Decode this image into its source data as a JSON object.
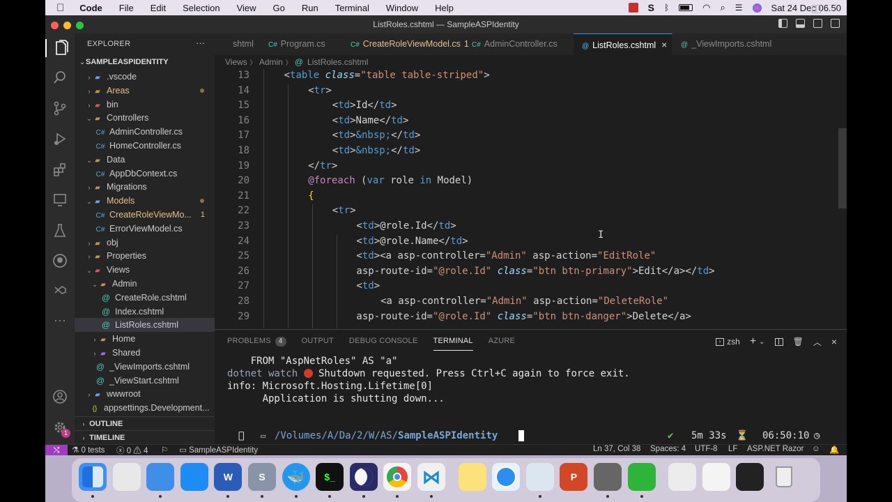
{
  "menubar": {
    "app": "Code",
    "items": [
      "File",
      "Edit",
      "Selection",
      "View",
      "Go",
      "Run",
      "Terminal",
      "Window",
      "Help"
    ],
    "clock": "Sat 24 Dec 06.50"
  },
  "window": {
    "title": "ListRoles.cshtml — SampleASPIdentity"
  },
  "sidebar": {
    "header": "EXPLORER",
    "project": "SAMPLEASPIDENTITY",
    "tree": [
      {
        "label": ".vscode",
        "depth": 0,
        "kind": "folder",
        "open": false,
        "icon_color": "#6c9ef8"
      },
      {
        "label": "Areas",
        "depth": 0,
        "kind": "folder",
        "open": false,
        "color": "#e2c08d",
        "dot": true
      },
      {
        "label": "bin",
        "depth": 0,
        "kind": "folder",
        "open": false,
        "icon_color": "#e05555"
      },
      {
        "label": "Controllers",
        "depth": 0,
        "kind": "folder",
        "open": true
      },
      {
        "label": "AdminController.cs",
        "depth": 1,
        "kind": "cs"
      },
      {
        "label": "HomeController.cs",
        "depth": 1,
        "kind": "cs"
      },
      {
        "label": "Data",
        "depth": 0,
        "kind": "folder",
        "open": true
      },
      {
        "label": "AppDbContext.cs",
        "depth": 1,
        "kind": "cs"
      },
      {
        "label": "Migrations",
        "depth": 0,
        "kind": "folder",
        "open": false
      },
      {
        "label": "Models",
        "depth": 0,
        "kind": "folder",
        "open": true,
        "color": "#e2c08d",
        "dot": true,
        "icon_color": "#6c9ef8"
      },
      {
        "label": "CreateRoleViewMo...",
        "depth": 1,
        "kind": "cs",
        "color": "#e2c08d",
        "badge": "1"
      },
      {
        "label": "ErrorViewModel.cs",
        "depth": 1,
        "kind": "cs"
      },
      {
        "label": "obj",
        "depth": 0,
        "kind": "folder",
        "open": false
      },
      {
        "label": "Properties",
        "depth": 0,
        "kind": "folder",
        "open": false
      },
      {
        "label": "Views",
        "depth": 0,
        "kind": "folder",
        "open": true,
        "icon_color": "#e05555"
      },
      {
        "label": "Admin",
        "depth": 1,
        "kind": "folder",
        "open": true
      },
      {
        "label": "CreateRole.cshtml",
        "depth": 2,
        "kind": "razor"
      },
      {
        "label": "Index.cshtml",
        "depth": 2,
        "kind": "razor"
      },
      {
        "label": "ListRoles.cshtml",
        "depth": 2,
        "kind": "razor",
        "selected": true
      },
      {
        "label": "Home",
        "depth": 1,
        "kind": "folder",
        "open": false
      },
      {
        "label": "Shared",
        "depth": 1,
        "kind": "folder",
        "open": false,
        "icon_color": "#9a6cf0"
      },
      {
        "label": "_ViewImports.cshtml",
        "depth": 1,
        "kind": "razor"
      },
      {
        "label": "_ViewStart.cshtml",
        "depth": 1,
        "kind": "razor"
      },
      {
        "label": "wwwroot",
        "depth": 0,
        "kind": "folder",
        "open": false,
        "icon_color": "#6c9ef8"
      },
      {
        "label": "appsettings.Development...",
        "depth": 0,
        "kind": "json"
      }
    ],
    "outline": "OUTLINE",
    "timeline": "TIMELINE"
  },
  "tabs": [
    {
      "label": "shtml",
      "icon": "",
      "partial": true
    },
    {
      "label": "Program.cs",
      "icon": "C#"
    },
    {
      "label": "CreateRoleViewModel.cs",
      "icon": "C#",
      "modified": true,
      "badge": "1"
    },
    {
      "label": "AdminController.cs",
      "icon": "C#"
    },
    {
      "label": "ListRoles.cshtml",
      "icon": "@",
      "active": true,
      "close": "×"
    },
    {
      "label": "_ViewImports.cshtml",
      "icon": "@"
    }
  ],
  "breadcrumb": {
    "parts": [
      "Views",
      "Admin",
      "ListRoles.cshtml"
    ],
    "sep": "〉",
    "razor_icon": "@"
  },
  "editor": {
    "lines": [
      {
        "n": "13",
        "indent": 1,
        "t": [
          [
            "<",
            "p"
          ],
          [
            "table",
            "tag"
          ],
          [
            " class",
            "attr-i"
          ],
          [
            "=",
            "p"
          ],
          [
            "\"table table-striped\"",
            "str"
          ],
          [
            ">",
            "p"
          ]
        ]
      },
      {
        "n": "14",
        "indent": 2,
        "t": [
          [
            "<",
            "p"
          ],
          [
            "tr",
            "tag"
          ],
          [
            ">",
            "p"
          ]
        ]
      },
      {
        "n": "15",
        "indent": 3,
        "t": [
          [
            "<",
            "p"
          ],
          [
            "td",
            "tag"
          ],
          [
            ">Id</",
            "p"
          ],
          [
            "td",
            "tag"
          ],
          [
            ">",
            "p"
          ]
        ]
      },
      {
        "n": "16",
        "indent": 3,
        "t": [
          [
            "<",
            "p"
          ],
          [
            "td",
            "tag"
          ],
          [
            ">Name</",
            "p"
          ],
          [
            "td",
            "tag"
          ],
          [
            ">",
            "p"
          ]
        ]
      },
      {
        "n": "17",
        "indent": 3,
        "t": [
          [
            "<",
            "p"
          ],
          [
            "td",
            "tag"
          ],
          [
            ">",
            "p"
          ],
          [
            "&nbsp;",
            "ent"
          ],
          [
            "</",
            "p"
          ],
          [
            "td",
            "tag"
          ],
          [
            ">",
            "p"
          ]
        ]
      },
      {
        "n": "18",
        "indent": 3,
        "t": [
          [
            "<",
            "p"
          ],
          [
            "td",
            "tag"
          ],
          [
            ">",
            "p"
          ],
          [
            "&nbsp;",
            "ent"
          ],
          [
            "</",
            "p"
          ],
          [
            "td",
            "tag"
          ],
          [
            ">",
            "p"
          ]
        ]
      },
      {
        "n": "19",
        "indent": 2,
        "t": [
          [
            "</",
            "p"
          ],
          [
            "tr",
            "tag"
          ],
          [
            ">",
            "p"
          ]
        ]
      },
      {
        "n": "20",
        "indent": 2,
        "t": [
          [
            "@foreach",
            "kw"
          ],
          [
            " (",
            "p"
          ],
          [
            "var",
            "kw2"
          ],
          [
            " role ",
            "p"
          ],
          [
            "in",
            "kw2"
          ],
          [
            " Model)",
            "p"
          ]
        ]
      },
      {
        "n": "21",
        "indent": 2,
        "t": [
          [
            "{",
            "brace"
          ]
        ]
      },
      {
        "n": "22",
        "indent": 3,
        "t": [
          [
            "<",
            "p"
          ],
          [
            "tr",
            "tag"
          ],
          [
            ">",
            "p"
          ]
        ]
      },
      {
        "n": "23",
        "indent": 4,
        "t": [
          [
            "<",
            "p"
          ],
          [
            "td",
            "tag"
          ],
          [
            ">@role.Id</",
            "p"
          ],
          [
            "td",
            "tag"
          ],
          [
            ">",
            "p"
          ]
        ]
      },
      {
        "n": "24",
        "indent": 4,
        "t": [
          [
            "<",
            "p"
          ],
          [
            "td",
            "tag"
          ],
          [
            ">@role.Name</",
            "p"
          ],
          [
            "td",
            "tag"
          ],
          [
            ">",
            "p"
          ]
        ]
      },
      {
        "n": "25",
        "indent": 4,
        "t": [
          [
            "<",
            "p"
          ],
          [
            "td",
            "tag"
          ],
          [
            "><a asp-controller=",
            "p"
          ],
          [
            "\"Admin\"",
            "str"
          ],
          [
            " asp-action=",
            "p"
          ],
          [
            "\"EditRole\"",
            "str"
          ]
        ]
      },
      {
        "n": "26",
        "indent": 4,
        "t": [
          [
            "asp-route-id=",
            "p"
          ],
          [
            "\"@role.Id\"",
            "str"
          ],
          [
            " class",
            "attr-i"
          ],
          [
            "=",
            "p"
          ],
          [
            "\"btn btn-primary\"",
            "str"
          ],
          [
            ">Edit</a></",
            "p"
          ],
          [
            "td",
            "tag"
          ],
          [
            ">",
            "p"
          ]
        ]
      },
      {
        "n": "27",
        "indent": 4,
        "t": [
          [
            "<",
            "p"
          ],
          [
            "td",
            "tag"
          ],
          [
            ">",
            "p"
          ]
        ]
      },
      {
        "n": "28",
        "indent": 5,
        "t": [
          [
            "<a asp-controller=",
            "p"
          ],
          [
            "\"Admin\"",
            "str"
          ],
          [
            " asp-action=",
            "p"
          ],
          [
            "\"DeleteRole\"",
            "str"
          ]
        ]
      },
      {
        "n": "29",
        "indent": 4,
        "t": [
          [
            "asp-route-id=",
            "p"
          ],
          [
            "\"@role.Id\"",
            "str"
          ],
          [
            " class",
            "attr-i"
          ],
          [
            "=",
            "p"
          ],
          [
            "\"btn btn-danger\"",
            "str"
          ],
          [
            ">Delete</a>",
            "p"
          ]
        ]
      }
    ]
  },
  "panel": {
    "tabs": [
      {
        "label": "PROBLEMS",
        "badge": "4"
      },
      {
        "label": "OUTPUT"
      },
      {
        "label": "DEBUG CONSOLE"
      },
      {
        "label": "TERMINAL",
        "active": true
      },
      {
        "label": "AZURE"
      }
    ],
    "shell": "zsh",
    "terminal": [
      {
        "pre": "    FROM \"AspNetRoles\" AS \"a\"",
        "text": ""
      },
      {
        "pre": "dotnet watch ",
        "stop": true,
        "text": " Shutdown requested. Press Ctrl+C again to force exit."
      },
      {
        "pre": "info: Microsoft.Hosting.Lifetime[0]",
        "text": ""
      },
      {
        "pre": "      Application is shutting down...",
        "text": ""
      }
    ],
    "prompt": {
      "path_dim": "/Volumes/A/Da/2/W/AS/",
      "path_bold": "SampleASPIdentity",
      "ok": "✔",
      "duration": "5m 33s",
      "time": "06:50:10"
    }
  },
  "statusbar": {
    "tests": "0 tests",
    "errors": "0",
    "warnings": "4",
    "project": "SampleASPIdentity",
    "position": "Ln 37, Col 38",
    "spaces": "Spaces: 4",
    "encoding": "UTF-8",
    "eol": "LF",
    "language": "ASP.NET Razor"
  },
  "dock": {
    "apps": [
      {
        "name": "finder-icon",
        "label": "",
        "bg": "#3d8ff0"
      },
      {
        "name": "launchpad-icon",
        "label": "",
        "bg": "#e8e8e8"
      },
      {
        "name": "mail-icon",
        "label": "",
        "bg": "#3f8fe8"
      },
      {
        "name": "app-store-icon",
        "label": "",
        "bg": "#1d8cf5"
      },
      {
        "name": "word-icon",
        "label": "W",
        "bg": "#2b5cb8"
      },
      {
        "name": "sonar-icon",
        "label": "S",
        "bg": "#8a94a8"
      },
      {
        "name": "docker-icon",
        "label": "",
        "bg": "#2496ed"
      },
      {
        "name": "terminal-icon",
        "label": "$_",
        "bg": "#111"
      },
      {
        "name": "eclipse-icon",
        "label": "",
        "bg": "#2a2b66"
      },
      {
        "name": "chrome-icon",
        "label": "",
        "bg": "#f4f4f4"
      },
      {
        "name": "vscode-icon",
        "label": "",
        "bg": "#f0f0f0"
      },
      {
        "name": "notes-icon",
        "label": "",
        "bg": "#fbe27a"
      },
      {
        "name": "safari-icon",
        "label": "",
        "bg": "#e8f2fc"
      },
      {
        "name": "preview-icon",
        "label": "",
        "bg": "#dce6f0"
      },
      {
        "name": "powerpoint-icon",
        "label": "P",
        "bg": "#d24726"
      },
      {
        "name": "database-icon",
        "label": "",
        "bg": "#666"
      },
      {
        "name": "camtasia-icon",
        "label": "",
        "bg": "#2fb43a"
      },
      {
        "name": "window-1-icon",
        "label": "",
        "bg": "#ececec"
      },
      {
        "name": "window-2-icon",
        "label": "",
        "bg": "#f4f4f4"
      },
      {
        "name": "window-3-icon",
        "label": "",
        "bg": "#222"
      },
      {
        "name": "trash-icon",
        "label": "",
        "bg": "#d8d8dc"
      }
    ]
  },
  "colors": {
    "accent": "#3a8ee6",
    "remote": "#a03dbf",
    "tag": "#569cd6",
    "string": "#ce9178",
    "attr": "#9cdcfe",
    "keyword": "#c586c0",
    "brace": "#ffd700",
    "entity": "#569cd6"
  }
}
